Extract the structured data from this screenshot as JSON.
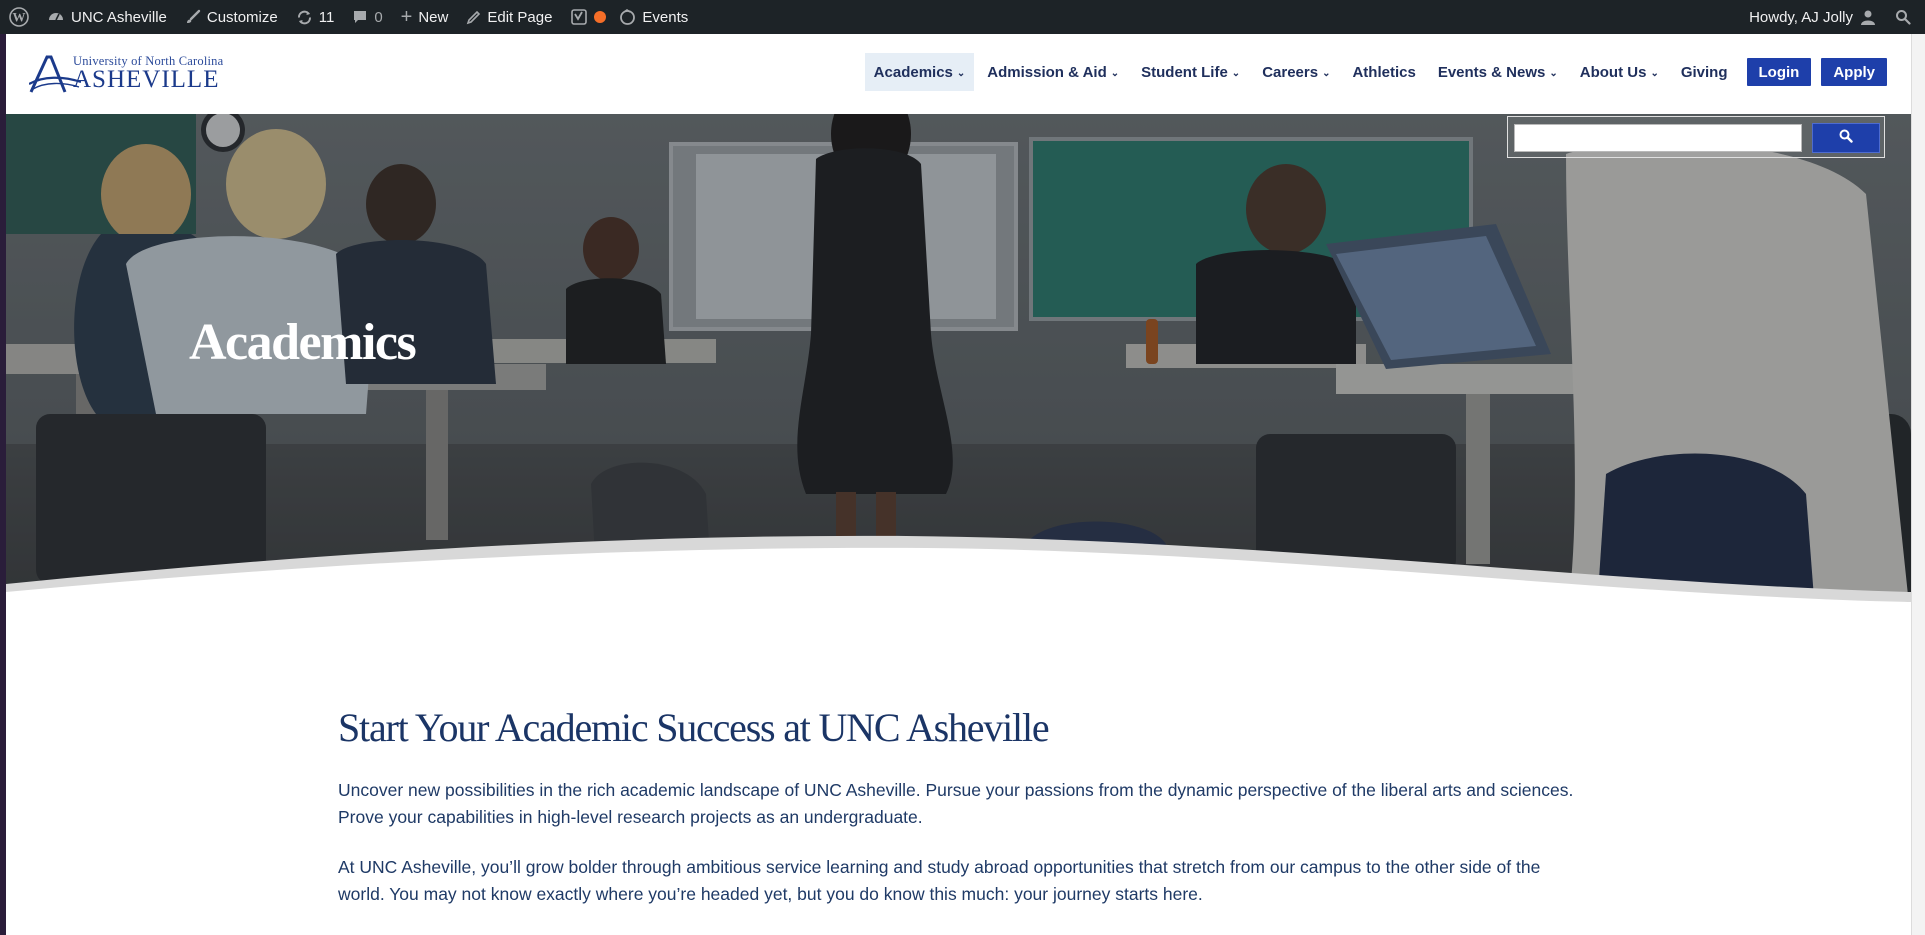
{
  "adminbar": {
    "site_name": "UNC Asheville",
    "customize": "Customize",
    "updates_count": "11",
    "comments_count": "0",
    "new_label": "New",
    "edit_page": "Edit Page",
    "events": "Events",
    "howdy": "Howdy, AJ Jolly"
  },
  "logo": {
    "line1": "University of North Carolina",
    "line2": "ASHEVILLE"
  },
  "nav": {
    "items": [
      {
        "label": "Academics",
        "has_dropdown": true,
        "active": true
      },
      {
        "label": "Admission & Aid",
        "has_dropdown": true
      },
      {
        "label": "Student Life",
        "has_dropdown": true
      },
      {
        "label": "Careers",
        "has_dropdown": true
      },
      {
        "label": "Athletics",
        "has_dropdown": false
      },
      {
        "label": "Events & News",
        "has_dropdown": true
      },
      {
        "label": "About Us",
        "has_dropdown": true
      },
      {
        "label": "Giving",
        "has_dropdown": false
      }
    ],
    "login": "Login",
    "apply": "Apply"
  },
  "search": {
    "value": "",
    "button_icon": "search-icon"
  },
  "hero": {
    "title": "Academics"
  },
  "content": {
    "heading": "Start Your Academic Success at UNC Asheville",
    "paragraphs": [
      "Uncover new possibilities in the rich academic landscape of UNC Asheville. Pursue your passions from the dynamic perspective of the liberal arts and sciences. Prove your capabilities in high-level research projects as an undergraduate.",
      "At UNC Asheville, you’ll grow bolder through ambitious service learning and study abroad opportunities that stretch from our campus to the other side of the world. You may not know exactly where you’re headed yet, but you do know this much: your journey starts here."
    ]
  },
  "colors": {
    "admin_bar": "#1d2327",
    "brand_blue": "#1e3faa",
    "nav_text": "#1f2f5c",
    "heading": "#1b3566",
    "active_nav_bg": "#e6eef6"
  }
}
